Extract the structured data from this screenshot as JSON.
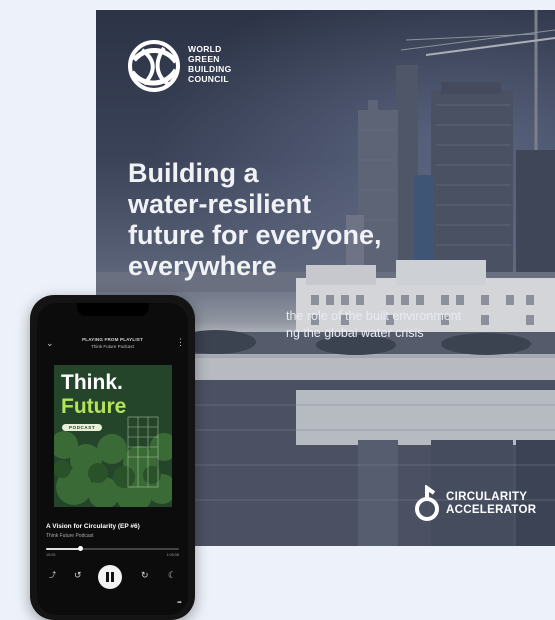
{
  "cover": {
    "logo_text": [
      "WORLD",
      "GREEN",
      "BUILDING",
      "COUNCIL"
    ],
    "headline": [
      "Building a",
      "water-resilient",
      "future for everyone,",
      "everywhere"
    ],
    "subline": [
      "the role of the built environment",
      "ng the global water crisis"
    ],
    "partner_text": [
      "CIRCULARITY",
      "ACCELERATOR"
    ],
    "logo_icon": "globe-swirl-icon",
    "partner_icon": "loop-arrow-icon"
  },
  "phone": {
    "playing_from": "PLAYING FROM PLAYLIST",
    "playlist_name": "Think Future Podcast",
    "artwork": {
      "line1": "Think.",
      "line2": "Future",
      "badge": "PODCAST",
      "accent": "#b5e35a"
    },
    "episode_title": "A Vision for Circularity (EP #6)",
    "show_name": "Think Future Podcast",
    "progress_fraction": 0.26,
    "time_elapsed": "15:05",
    "time_total": "1:05:08",
    "icons": {
      "back": "chevron-down-icon",
      "more": "more-vertical-icon",
      "speed": "speed-icon",
      "rewind": "rewind-15-icon",
      "play_pause": "pause-icon",
      "forward": "forward-15-icon",
      "sleep": "moon-icon",
      "share": "share-icon"
    }
  }
}
